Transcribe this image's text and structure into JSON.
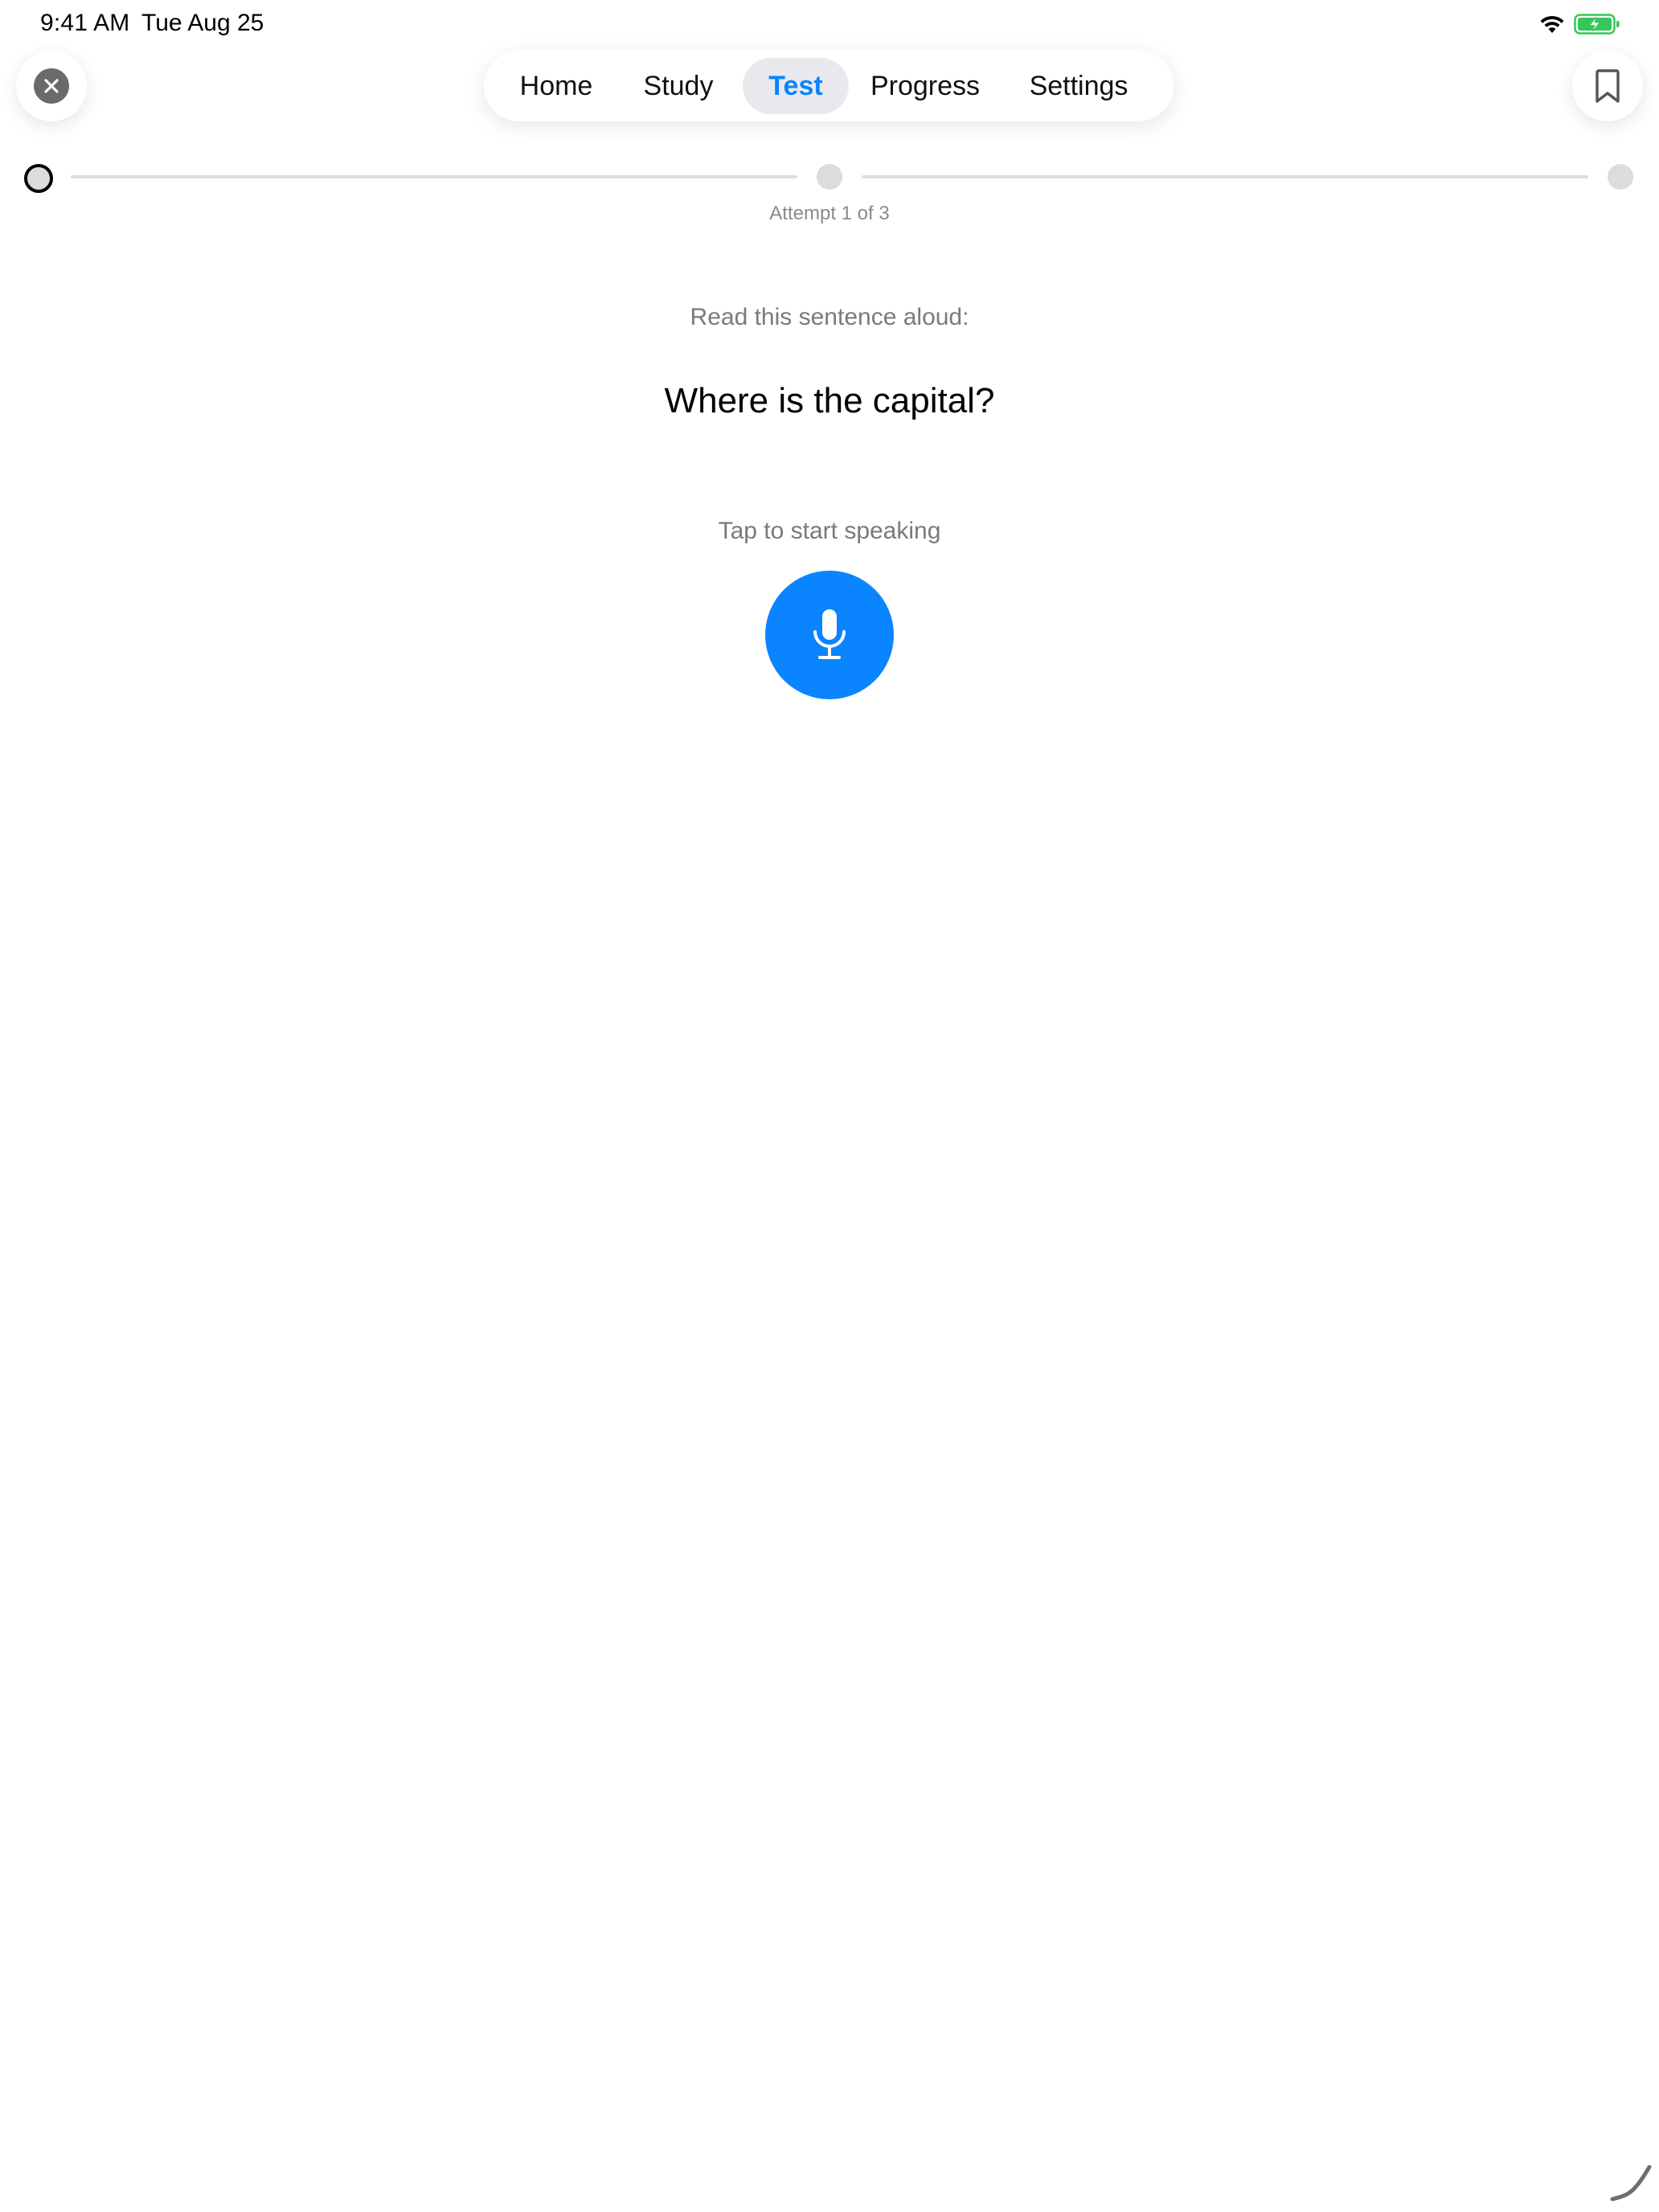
{
  "status_bar": {
    "time": "9:41 AM",
    "date": "Tue Aug 25",
    "icons": [
      "wifi-icon",
      "battery-charging-icon"
    ]
  },
  "header": {
    "close_icon": "close-icon",
    "bookmark_icon": "bookmark-icon"
  },
  "tabs": [
    {
      "label": "Home",
      "active": false
    },
    {
      "label": "Study",
      "active": false
    },
    {
      "label": "Test",
      "active": true
    },
    {
      "label": "Progress",
      "active": false
    },
    {
      "label": "Settings",
      "active": false
    }
  ],
  "progress": {
    "current_step": 1,
    "total_steps": 3,
    "attempt_text": "Attempt 1 of 3"
  },
  "prompt": {
    "instruction": "Read this sentence aloud:",
    "sentence": "Where is the capital?",
    "tap_hint": "Tap to start speaking",
    "mic_icon": "microphone-icon"
  },
  "colors": {
    "accent": "#0a84ff",
    "active_tab_bg": "#e9e9ed",
    "muted_text": "#7a7a7e",
    "battery_green": "#34c759"
  }
}
